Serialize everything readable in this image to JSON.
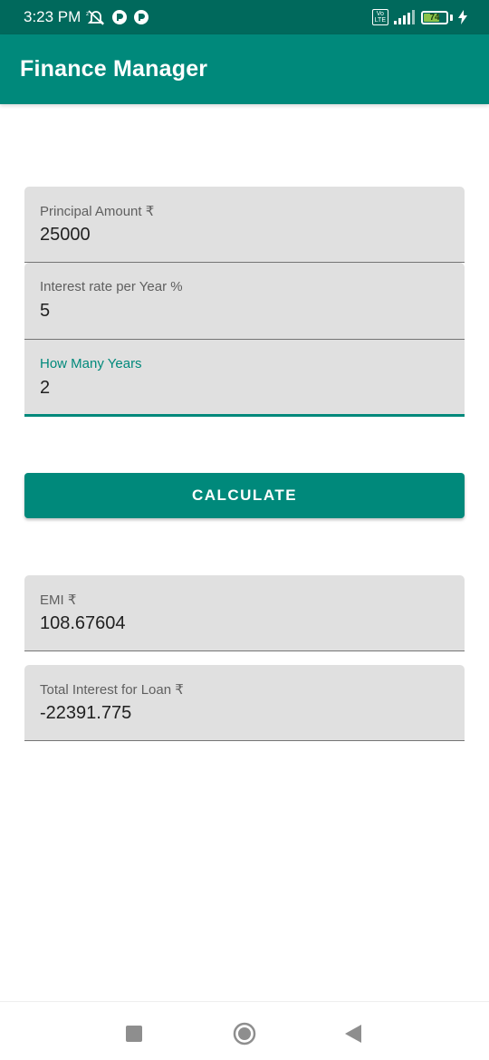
{
  "status_bar": {
    "time": "3:23 PM",
    "volte": "Vo\nLTE",
    "battery_level": "74",
    "battery_fraction": 0.74
  },
  "app_bar": {
    "title": "Finance Manager"
  },
  "form": {
    "principal": {
      "label": "Principal Amount ₹",
      "value": "25000"
    },
    "interest": {
      "label": "Interest rate per Year %",
      "value": "5"
    },
    "years": {
      "label": "How Many Years",
      "value": "2"
    }
  },
  "calculate_label": "CALCULATE",
  "results": {
    "emi": {
      "label": "EMI ₹",
      "value": "108.67604"
    },
    "total_interest": {
      "label": "Total Interest for Loan ₹",
      "value": "-22391.775"
    }
  },
  "colors": {
    "status_bar": "#00695c",
    "primary": "#00897b",
    "field_bg": "#e0e0e0"
  },
  "icons": {
    "status": [
      "alarm-off-icon",
      "circle-app-icon",
      "circle-app-icon",
      "signal-icon",
      "battery-icon",
      "charging-icon"
    ],
    "nav": [
      "recents-square-icon",
      "home-circle-icon",
      "back-triangle-icon"
    ]
  }
}
